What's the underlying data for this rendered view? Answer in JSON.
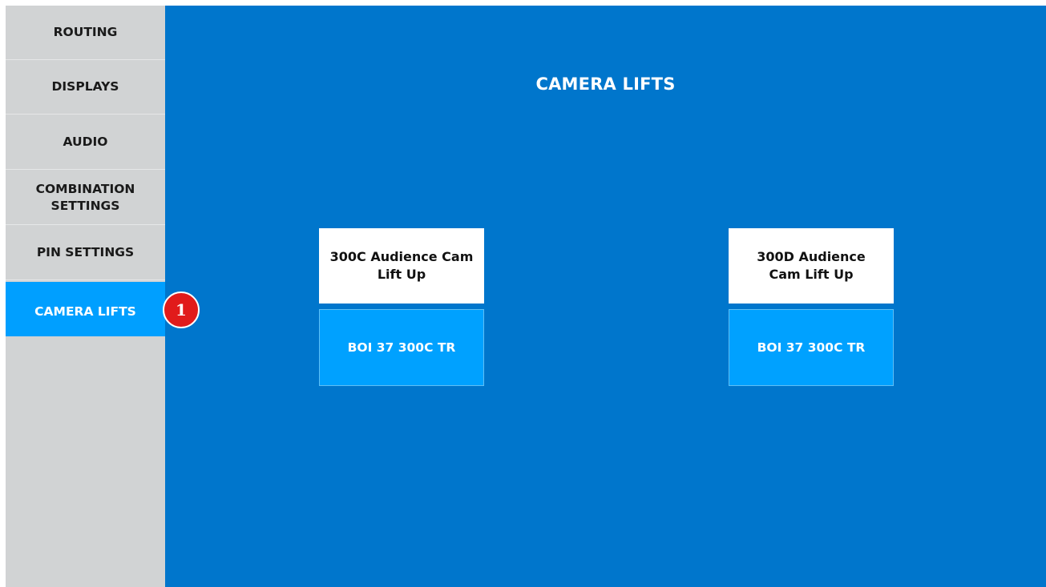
{
  "sidebar": {
    "items": [
      {
        "label": "ROUTING"
      },
      {
        "label": "DISPLAYS"
      },
      {
        "label": "AUDIO"
      },
      {
        "label": "COMBINATION\nSETTINGS"
      },
      {
        "label": "PIN SETTINGS"
      },
      {
        "label": "CAMERA LIFTS",
        "active": true
      }
    ]
  },
  "main": {
    "title": "CAMERA LIFTS",
    "lifts": [
      {
        "label": "300C Audience Cam Lift Up",
        "tr_label": "BOI 37 300C TR"
      },
      {
        "label": "300D Audience Cam Lift Up",
        "tr_label": "BOI 37 300C TR"
      }
    ]
  },
  "annotation": {
    "badge_text": "1"
  },
  "colors": {
    "sidebar_bg": "#d1d3d4",
    "main_bg": "#0076cc",
    "active_accent": "#009fff",
    "badge": "#e11b1b"
  }
}
